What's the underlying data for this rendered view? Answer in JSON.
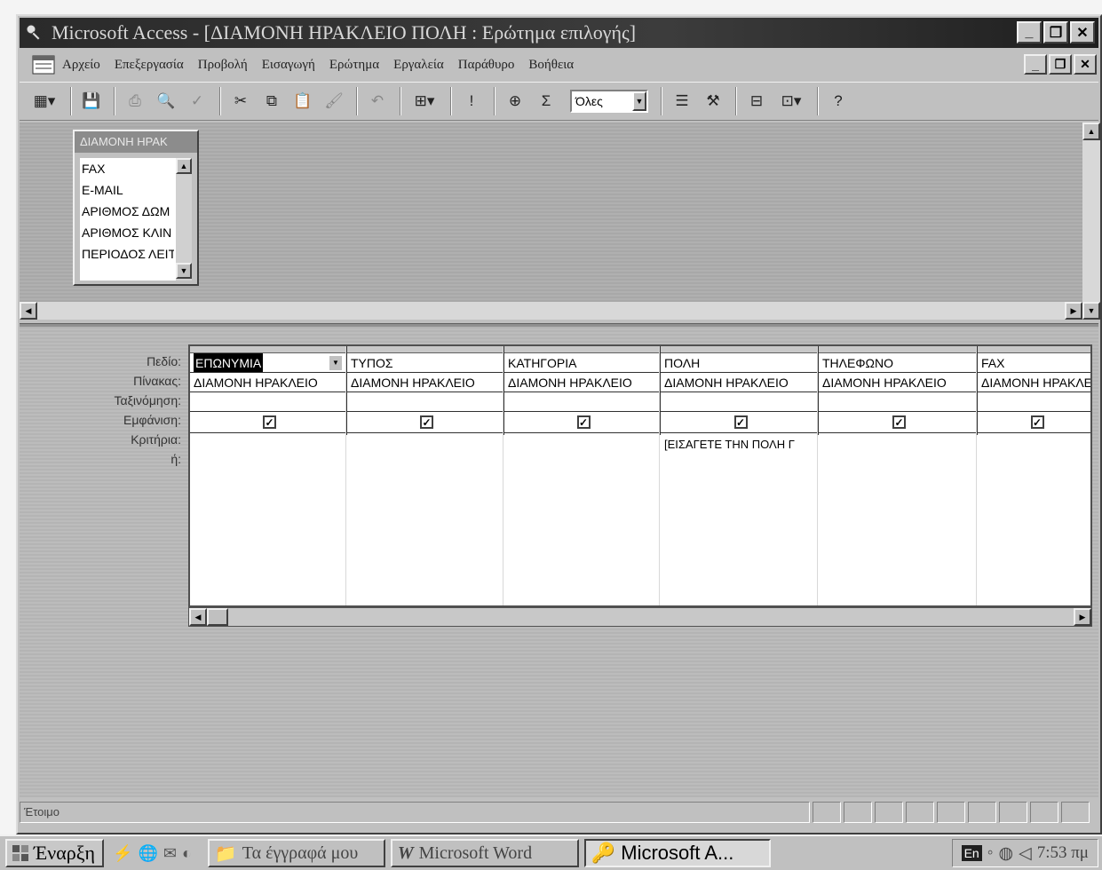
{
  "window": {
    "title": "Microsoft Access - [ΔΙΑΜΟΝΗ ΗΡΑΚΛΕΙΟ ΠΟΛΗ : Ερώτημα επιλογής]"
  },
  "menubar": {
    "items": [
      "Αρχείο",
      "Επεξεργασία",
      "Προβολή",
      "Εισαγωγή",
      "Ερώτημα",
      "Εργαλεία",
      "Παράθυρο",
      "Βοήθεια"
    ]
  },
  "toolbar": {
    "top_values": "Όλες"
  },
  "field_list": {
    "title": "ΔΙΑΜΟΝΗ ΗΡΑΚ",
    "items": [
      "FAX",
      "E-MAIL",
      "ΑΡΙΘΜΟΣ ΔΩΜ",
      "ΑΡΙΘΜΟΣ ΚΛΙΝ",
      "ΠΕΡΙΟΔΟΣ ΛΕΙΤ"
    ]
  },
  "grid": {
    "row_labels": [
      "Πεδίο:",
      "Πίνακας:",
      "Ταξινόμηση:",
      "Εμφάνιση:",
      "Κριτήρια:",
      "ή:"
    ],
    "columns": [
      {
        "field": "ΕΠΩΝΥΜΙΑ",
        "table": "ΔΙΑΜΟΝΗ ΗΡΑΚΛΕΙΟ",
        "show": true,
        "criteria": ""
      },
      {
        "field": "ΤΥΠΟΣ",
        "table": "ΔΙΑΜΟΝΗ ΗΡΑΚΛΕΙΟ",
        "show": true,
        "criteria": ""
      },
      {
        "field": "ΚΑΤΗΓΟΡΙΑ",
        "table": "ΔΙΑΜΟΝΗ ΗΡΑΚΛΕΙΟ",
        "show": true,
        "criteria": ""
      },
      {
        "field": "ΠΟΛΗ",
        "table": "ΔΙΑΜΟΝΗ ΗΡΑΚΛΕΙΟ",
        "show": true,
        "criteria": "[ΕΙΣΑΓΕΤΕ ΤΗΝ ΠΟΛΗ Γ"
      },
      {
        "field": "ΤΗΛΕΦΩΝΟ",
        "table": "ΔΙΑΜΟΝΗ ΗΡΑΚΛΕΙΟ",
        "show": true,
        "criteria": ""
      },
      {
        "field": "FAX",
        "table": "ΔΙΑΜΟΝΗ ΗΡΑΚΛΕΙΟ",
        "show": true,
        "criteria": ""
      }
    ]
  },
  "status": {
    "text": "Έτοιμο"
  },
  "taskbar": {
    "start": "Έναρξη",
    "tasks": [
      "Τα έγγραφά μου",
      "Microsoft Word",
      "Microsoft A..."
    ],
    "lang": "En",
    "clock": "7:53 πμ"
  }
}
